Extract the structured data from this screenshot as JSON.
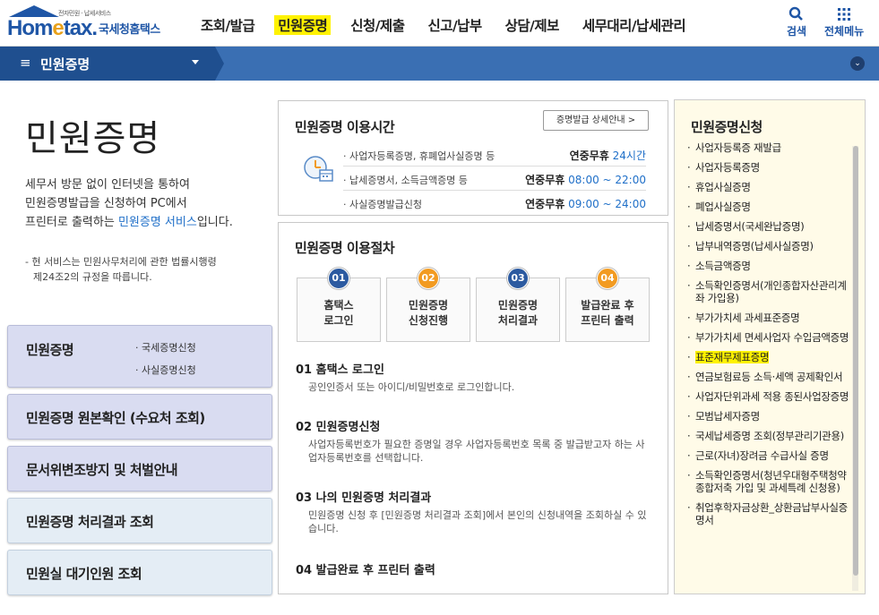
{
  "header": {
    "logo_small": "전자민원 · 납세서비스",
    "logo_main_1": "Hom",
    "logo_main_e": "e",
    "logo_main_2": "tax.",
    "logo_kr": "국세청홈택스",
    "nav": [
      "조회/발급",
      "민원증명",
      "신청/제출",
      "신고/납부",
      "상담/제보",
      "세무대리/납세관리"
    ],
    "search_label": "검색",
    "menu_label": "전체메뉴"
  },
  "locbar": {
    "current": "민원증명"
  },
  "intro": {
    "title": "민원증명",
    "desc_line1": "세무서 방문 없이 인터넷을 통하여",
    "desc_line2": "민원증명발급을 신청하여 PC에서",
    "desc_line3_pre": "프린터로 출력하는 ",
    "desc_line3_link": "민원증명 서비스",
    "desc_line3_post": "입니다.",
    "note_line1": "- 현 서비스는 민원사무처리에 관한 법률시행령",
    "note_line2": "제24조2의 규정을 따릅니다."
  },
  "left_menu": {
    "m1": "민원증명",
    "m1_sub1": "· 국세증명신청",
    "m1_sub2": "· 사실증명신청",
    "m2": "민원증명 원본확인 (수요처 조회)",
    "m3": "문서위변조방지 및 처벌안내",
    "m4": "민원증명 처리결과 조회",
    "m5": "민원실 대기인원 조회"
  },
  "usage_time": {
    "title": "민원증명 이용시간",
    "detail_button": "증명발급 상세안내 >",
    "rows": [
      {
        "name": "· 사업자등록증명, 휴폐업사실증명 등",
        "label": "연중무휴",
        "value": "24시간"
      },
      {
        "name": "· 납세증명서, 소득금액증명 등",
        "label": "연중무휴",
        "value": "08:00 ~ 22:00"
      },
      {
        "name": "· 사실증명발급신청",
        "label": "연중무휴",
        "value": "09:00 ~ 24:00"
      }
    ]
  },
  "procedure": {
    "title": "민원증명 이용절차",
    "steps": [
      {
        "num": "01",
        "label": "홈택스\n로그인"
      },
      {
        "num": "02",
        "label": "민원증명\n신청진행"
      },
      {
        "num": "03",
        "label": "민원증명\n처리결과"
      },
      {
        "num": "04",
        "label": "발급완료 후\n프린터 출력"
      }
    ],
    "details": [
      {
        "title": "01 홈택스 로그인",
        "desc": "공인인증서 또는 아이디/비밀번호로 로그인합니다."
      },
      {
        "title": "02 민원증명신청",
        "desc": "사업자등록번호가 필요한 증명일 경우 사업자등록번호 목록 중 발급받고자 하는 사업자등록번호를 선택합니다."
      },
      {
        "title": "03 나의 민원증명 처리결과",
        "desc": "민원증명 신청 후 [민원증명 처리결과 조회]에서 본인의 신청내역을 조회하실 수 있습니다."
      },
      {
        "title": "04 발급완료 후 프린터 출력",
        "desc": ""
      }
    ]
  },
  "right_panel": {
    "title": "민원증명신청",
    "items": [
      "사업자등록증 재발급",
      "사업자등록증명",
      "휴업사실증명",
      "폐업사실증명",
      "납세증명서(국세완납증명)",
      "납부내역증명(납세사실증명)",
      "소득금액증명",
      "소득확인증명서(개인종합자산관리계좌 가입용)",
      "부가가치세 과세표준증명",
      "부가가치세 면세사업자 수입금액증명",
      "표준재무제표증명",
      "연금보험료등 소득·세액 공제확인서",
      "사업자단위과세 적용 종된사업장증명",
      "모범납세자증명",
      "국세납세증명 조회(정부관리기관용)",
      "근로(자녀)장려금 수급사실 증명",
      "소득확인증명서(청년우대형주택청약종합저축 가입 및 과세특례 신청용)",
      "취업후학자금상환_상환금납부사실증명서"
    ]
  },
  "colors": {
    "brand_blue": "#1f56a6",
    "highlight_yellow": "#fff200",
    "step_blue": "#2c5aa0",
    "step_orange": "#f29b22"
  }
}
